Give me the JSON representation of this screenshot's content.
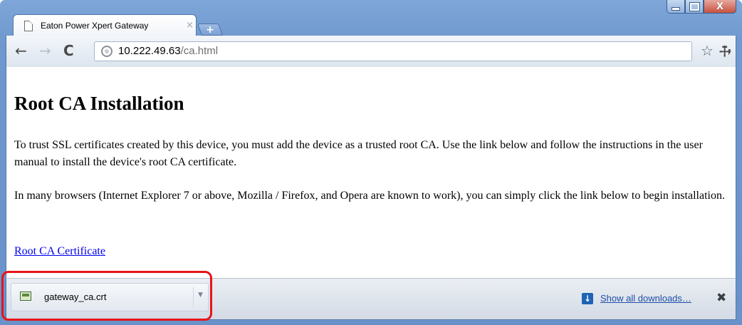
{
  "window": {
    "tab_title": "Eaton Power Xpert Gateway",
    "tab_close": "×",
    "new_tab": "+",
    "controls": {
      "minimize": "–",
      "maximize": "□",
      "close": "X"
    }
  },
  "toolbar": {
    "back": "←",
    "forward": "→",
    "reload": "C",
    "url_host": "10.222.49.63",
    "url_path": "/ca.html",
    "star": "☆",
    "wrench": "🔧"
  },
  "page": {
    "heading": "Root CA Installation",
    "paragraph1": "To trust SSL certificates created by this device, you must add the device as a trusted root CA. Use the link below and follow the instructions in the user manual to install the device's root CA certificate.",
    "paragraph2": "In many browsers (Internet Explorer 7 or above, Mozilla / Firefox, and Opera are known to work), you can simply click the link below to begin installation.",
    "link": "Root CA Certificate"
  },
  "downloads": {
    "file_name": "gateway_ca.crt",
    "menu_arrow": "▼",
    "show_all": "Show all downloads…",
    "show_all_icon": "↓",
    "close": "✖"
  },
  "colors": {
    "highlight": "#e8141a",
    "link": "#0000ee",
    "frame": "#6892c9"
  }
}
